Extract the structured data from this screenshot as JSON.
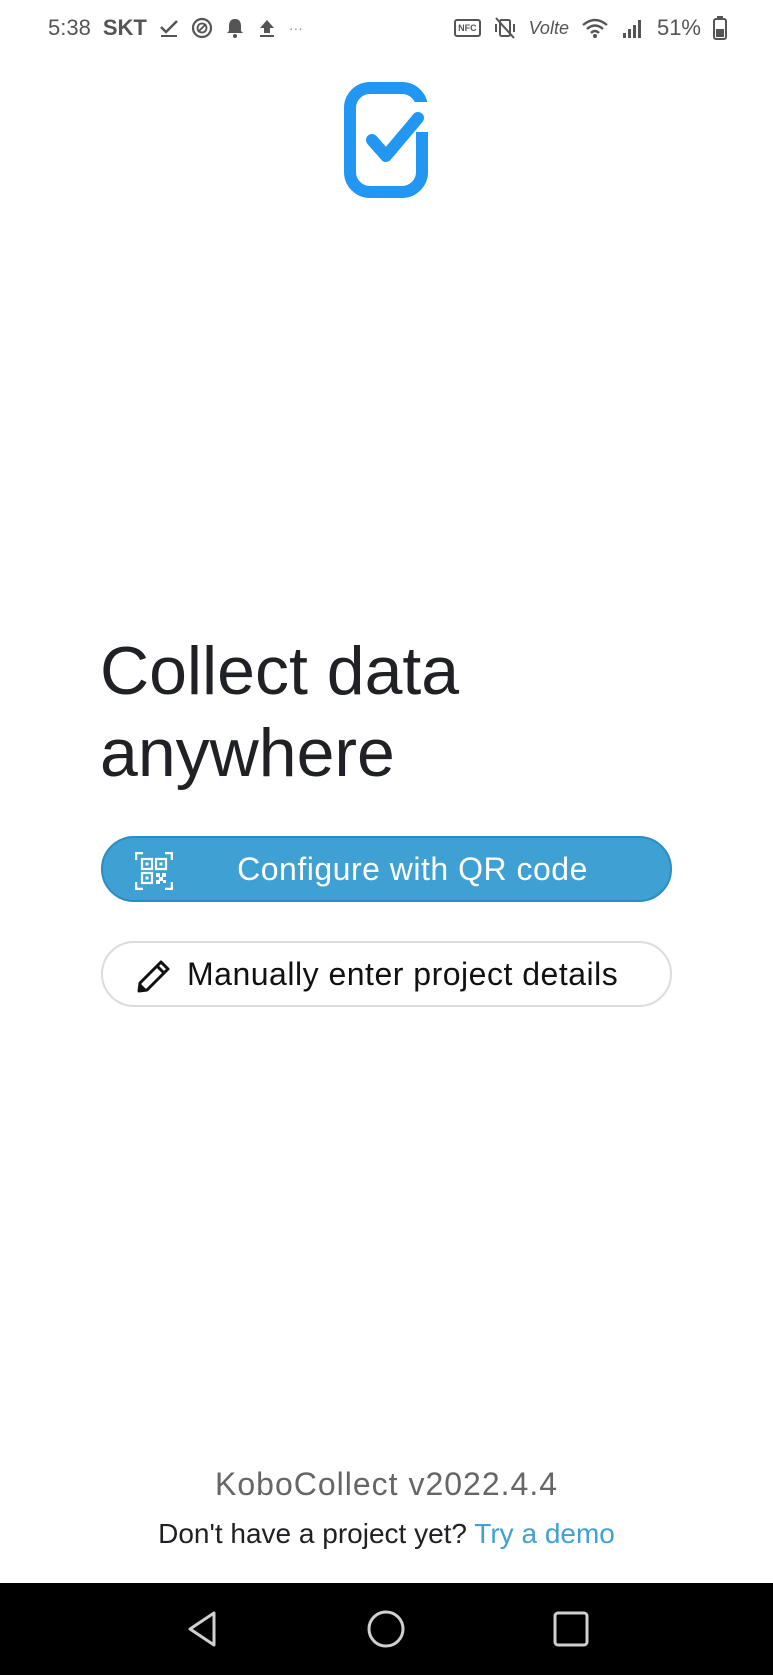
{
  "status_bar": {
    "time": "5:38",
    "carrier": "SKT",
    "battery": "51%",
    "left_icons": [
      "check-download-icon",
      "data-saver-icon",
      "notification-bell-icon",
      "upload-icon",
      "more-dots-icon"
    ],
    "right_icons": [
      "nfc-icon",
      "vibrate-mute-icon",
      "volte-icon",
      "wifi-icon",
      "signal-icon",
      "battery-icon"
    ],
    "volte_label": "Volte",
    "nfc_label": "NFC",
    "more_label": "···"
  },
  "app": {
    "logo_color": "#2196f3",
    "headline_line1": "Collect data",
    "headline_line2": "anywhere",
    "qr_button_label": "Configure with QR code",
    "manual_button_label": "Manually enter project details",
    "version": "KoboCollect v2022.4.4",
    "demo_prompt": "Don't have a project yet?",
    "demo_link": "Try a demo",
    "accent_color": "#3fa0d3"
  },
  "nav_bar": {
    "buttons": [
      "back-icon",
      "home-icon",
      "recents-icon"
    ]
  }
}
